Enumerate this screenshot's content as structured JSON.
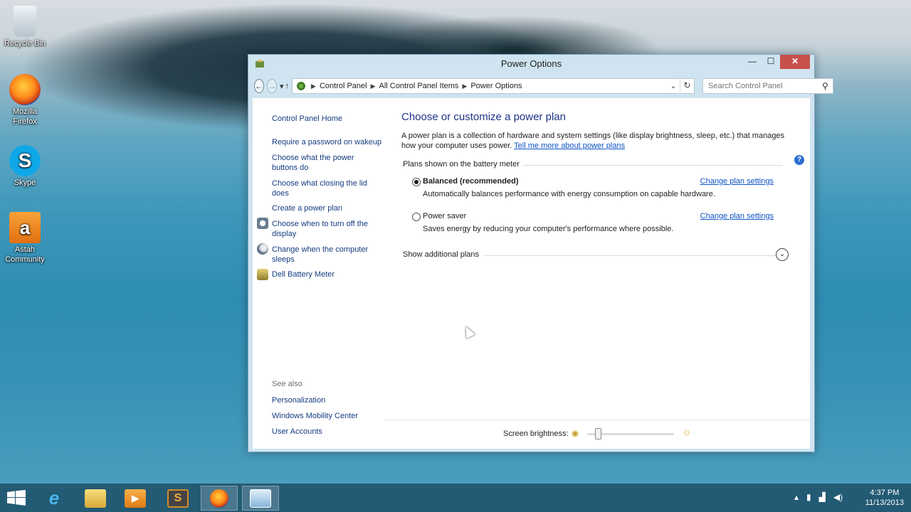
{
  "desktop": {
    "icons": [
      {
        "label": "Recycle Bin",
        "icon": "recycle-bin-icon"
      },
      {
        "label": "Mozilla Firefox",
        "icon": "firefox-icon"
      },
      {
        "label": "Skype",
        "icon": "skype-icon"
      },
      {
        "label": "Astah Community",
        "icon": "astah-icon"
      }
    ]
  },
  "window": {
    "title": "Power Options",
    "controls": {
      "minimize": "—",
      "maximize": "☐",
      "close": "✕"
    },
    "breadcrumbs": [
      "Control Panel",
      "All Control Panel Items",
      "Power Options"
    ],
    "search_placeholder": "Search Control Panel"
  },
  "left_pane": {
    "home": "Control Panel Home",
    "links": [
      "Require a password on wakeup",
      "Choose what the power buttons do",
      "Choose what closing the lid does",
      "Create a power plan",
      "Choose when to turn off the display",
      "Change when the computer sleeps",
      "Dell Battery Meter"
    ],
    "see_also_label": "See also",
    "see_also": [
      "Personalization",
      "Windows Mobility Center",
      "User Accounts"
    ]
  },
  "main": {
    "heading": "Choose or customize a power plan",
    "description": "A power plan is a collection of hardware and system settings (like display brightness, sleep, etc.) that manages how your computer uses power.",
    "learn_more_link": "Tell me more about power plans",
    "section_label": "Plans shown on the battery meter",
    "plans": [
      {
        "name": "Balanced (recommended)",
        "selected": true,
        "description": "Automatically balances performance with energy consumption on capable hardware.",
        "link": "Change plan settings"
      },
      {
        "name": "Power saver",
        "selected": false,
        "description": "Saves energy by reducing your computer's performance where possible.",
        "link": "Change plan settings"
      }
    ],
    "additional_plans": "Show additional plans",
    "brightness_label": "Screen brightness:",
    "brightness_level": 0.12
  },
  "taskbar": {
    "apps": [
      "internet-explorer-icon",
      "file-explorer-icon",
      "media-player-icon",
      "slides-icon",
      "firefox-icon",
      "control-panel-icon"
    ],
    "time": "4:37 PM",
    "date": "11/13/2013"
  },
  "colors": {
    "link": "#153b80",
    "heading": "#1e3287",
    "close_button": "#c7504b"
  }
}
